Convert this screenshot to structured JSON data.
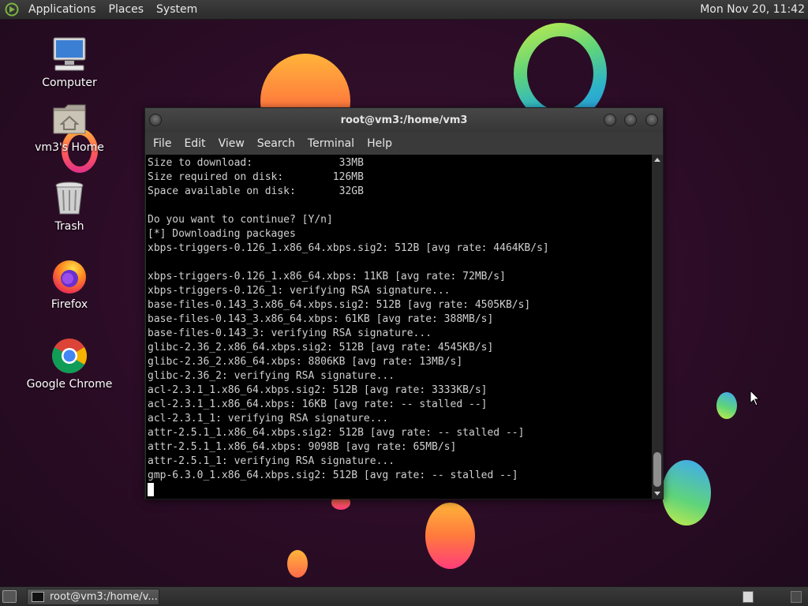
{
  "top_panel": {
    "menus": [
      "Applications",
      "Places",
      "System"
    ],
    "clock": "Mon Nov 20, 11:42"
  },
  "desktop": {
    "icons": [
      {
        "label": "Computer",
        "icon": "computer-icon"
      },
      {
        "label": "vm3's Home",
        "icon": "home-folder-icon"
      },
      {
        "label": "Trash",
        "icon": "trash-icon"
      },
      {
        "label": "Firefox",
        "icon": "firefox-icon"
      },
      {
        "label": "Google Chrome",
        "icon": "chrome-icon"
      }
    ]
  },
  "window": {
    "title": "root@vm3:/home/vm3",
    "menus": [
      "File",
      "Edit",
      "View",
      "Search",
      "Terminal",
      "Help"
    ]
  },
  "terminal": {
    "lines": [
      "Size to download:              33MB",
      "Size required on disk:        126MB",
      "Space available on disk:       32GB",
      "",
      "Do you want to continue? [Y/n]",
      "[*] Downloading packages",
      "xbps-triggers-0.126_1.x86_64.xbps.sig2: 512B [avg rate: 4464KB/s]",
      "",
      "xbps-triggers-0.126_1.x86_64.xbps: 11KB [avg rate: 72MB/s]",
      "xbps-triggers-0.126_1: verifying RSA signature...",
      "base-files-0.143_3.x86_64.xbps.sig2: 512B [avg rate: 4505KB/s]",
      "base-files-0.143_3.x86_64.xbps: 61KB [avg rate: 388MB/s]",
      "base-files-0.143_3: verifying RSA signature...",
      "glibc-2.36_2.x86_64.xbps.sig2: 512B [avg rate: 4545KB/s]",
      "glibc-2.36_2.x86_64.xbps: 8806KB [avg rate: 13MB/s]",
      "glibc-2.36_2: verifying RSA signature...",
      "acl-2.3.1_1.x86_64.xbps.sig2: 512B [avg rate: 3333KB/s]",
      "acl-2.3.1_1.x86_64.xbps: 16KB [avg rate: -- stalled --]",
      "acl-2.3.1_1: verifying RSA signature...",
      "attr-2.5.1_1.x86_64.xbps.sig2: 512B [avg rate: -- stalled --]",
      "attr-2.5.1_1.x86_64.xbps: 9098B [avg rate: 65MB/s]",
      "attr-2.5.1_1: verifying RSA signature...",
      "gmp-6.3.0_1.x86_64.xbps.sig2: 512B [avg rate: -- stalled --]"
    ]
  },
  "taskbar": {
    "task_label": "root@vm3:/home/v..."
  }
}
